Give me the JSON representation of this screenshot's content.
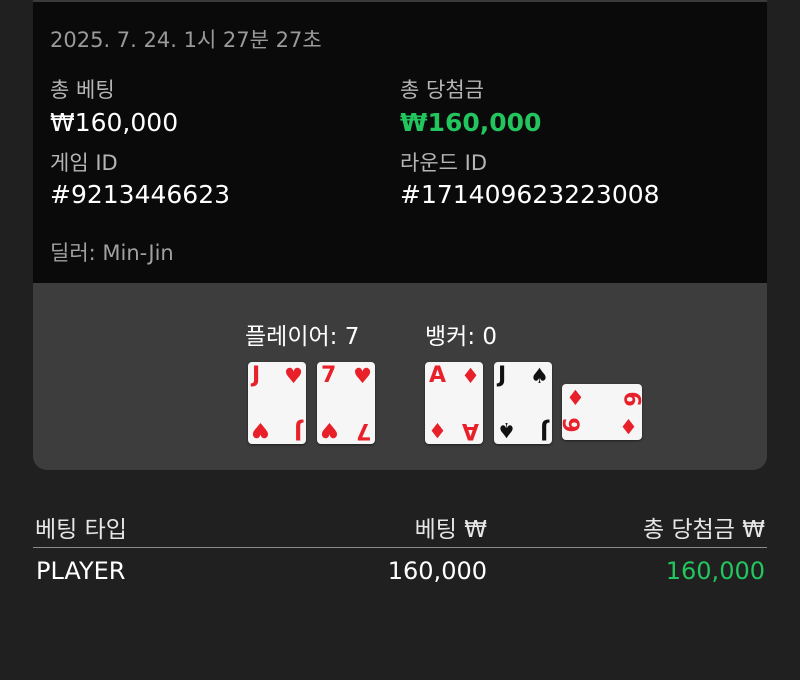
{
  "round": {
    "timestamp": "2025. 7. 24. 1시 27분 27초",
    "total_bet_label": "총 베팅",
    "total_bet_value": "₩160,000",
    "total_win_label": "총 당첨금",
    "total_win_value": "₩160,000",
    "game_id_label": "게임 ID",
    "game_id_value": "#9213446623",
    "round_id_label": "라운드 ID",
    "round_id_value": "#171409623223008",
    "dealer": "딜러: Min-Jin"
  },
  "result": {
    "player_score": "플레이어: 7",
    "banker_score": "뱅커: 0",
    "player_cards": [
      {
        "rank": "J",
        "suit": "♥",
        "color": "red"
      },
      {
        "rank": "7",
        "suit": "♥",
        "color": "red"
      }
    ],
    "banker_cards": [
      {
        "rank": "A",
        "suit": "♦",
        "color": "red"
      },
      {
        "rank": "J",
        "suit": "♠",
        "color": "black"
      },
      {
        "rank": "6",
        "suit": "♦",
        "color": "red",
        "sideways": true
      }
    ]
  },
  "bets_table": {
    "headers": [
      "베팅 타입",
      "베팅 ₩",
      "총 당첨금 ₩"
    ],
    "rows": [
      {
        "type": "PLAYER",
        "bet": "160,000",
        "win": "160,000"
      }
    ]
  },
  "colors": {
    "win_green": "#22c55e",
    "card_red": "#e8202a",
    "background": "#202020",
    "panel": "#3d3d3d"
  }
}
